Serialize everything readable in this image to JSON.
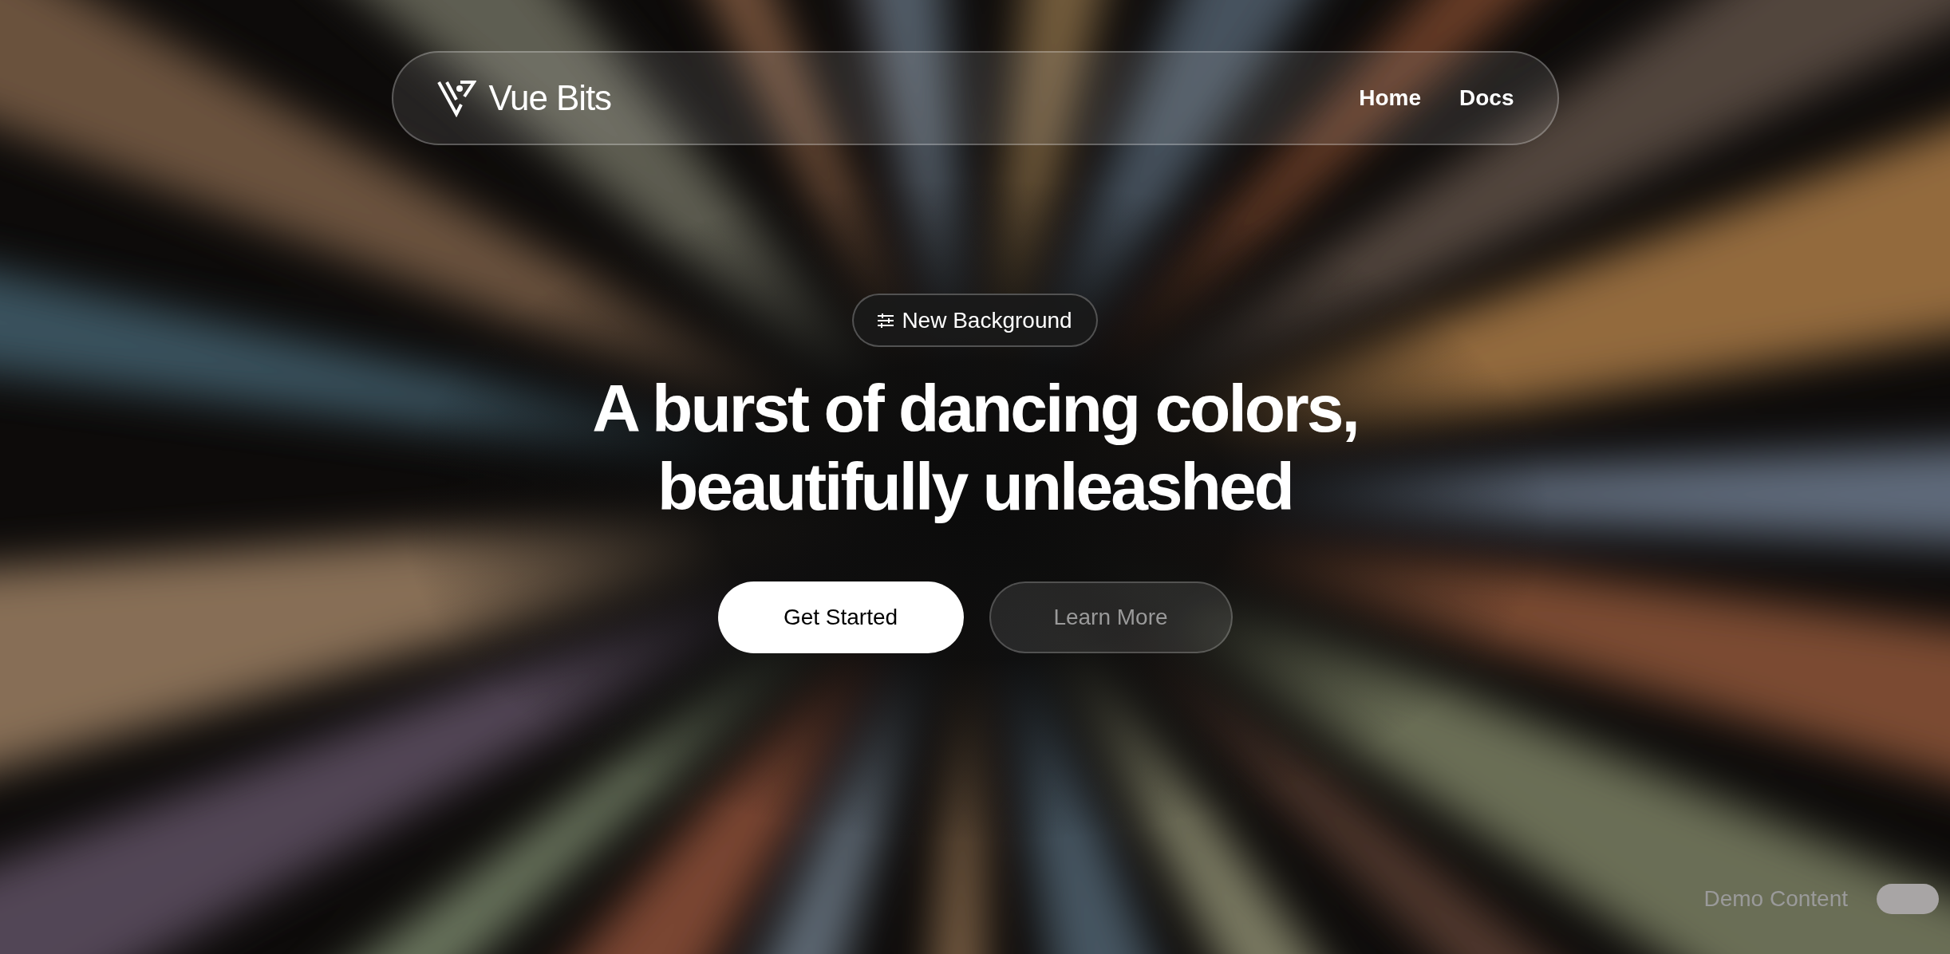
{
  "nav": {
    "brand": "Vue Bits",
    "links": [
      "Home",
      "Docs"
    ]
  },
  "hero": {
    "badge": "New Background",
    "headline_lines": [
      "A burst of dancing colors,",
      "beautifully unleashed"
    ],
    "primary_button": "Get Started",
    "secondary_button": "Learn More"
  },
  "demo_toggle": {
    "label": "Demo Content",
    "on": true
  }
}
